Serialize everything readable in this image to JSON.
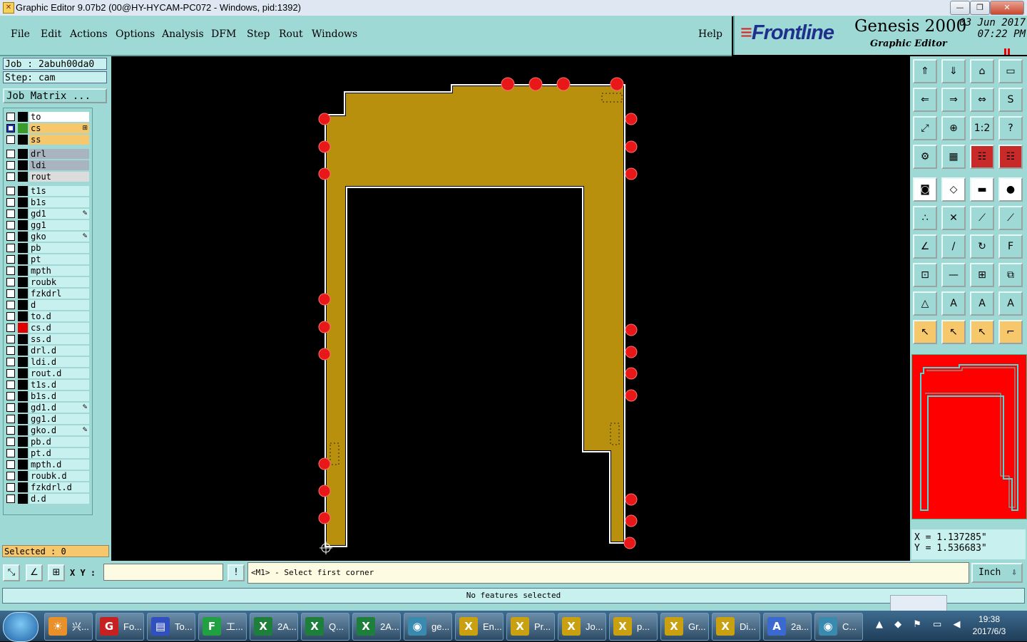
{
  "window": {
    "title": "Graphic Editor 9.07b2 (00@HY-HYCAM-PC072 - Windows, pid:1392)",
    "minimize": "—",
    "maximize": "❐",
    "close": "✕"
  },
  "menu": [
    "File",
    "Edit",
    "Actions",
    "Options",
    "Analysis",
    "DFM",
    "Step",
    "Rout",
    "Windows",
    "Help"
  ],
  "brand": {
    "logo": "Frontline",
    "product": "Genesis 2000",
    "subtitle": "Graphic Editor",
    "date": "03 Jun 2017",
    "time": "07:22 PM"
  },
  "job": {
    "job_label": "Job : 2abuh00da0",
    "step_label": "Step: cam",
    "matrix_button": "Job Matrix ..."
  },
  "layers": [
    {
      "name": "to",
      "color": "#ffffff",
      "swatch": "#000000",
      "checked": false
    },
    {
      "name": "cs",
      "color": "#f7c86b",
      "swatch": "#3a9a2a",
      "checked": true,
      "mark": "⊞"
    },
    {
      "name": "ss",
      "color": "#f7c86b",
      "swatch": "#000000",
      "checked": false
    },
    {
      "name": "drl",
      "color": "#aab4c0",
      "swatch": "#000000",
      "checked": false,
      "gap": true
    },
    {
      "name": "ldi",
      "color": "#aab4c0",
      "swatch": "#000000",
      "checked": false
    },
    {
      "name": "rout",
      "color": "#dcdcdc",
      "swatch": "#000000",
      "checked": false
    },
    {
      "name": "t1s",
      "color": "#c8f0ee",
      "swatch": "#000000",
      "checked": false,
      "gap": true
    },
    {
      "name": "b1s",
      "color": "#c8f0ee",
      "swatch": "#000000",
      "checked": false
    },
    {
      "name": "gd1",
      "color": "#c8f0ee",
      "swatch": "#000000",
      "checked": false,
      "mark": "✎"
    },
    {
      "name": "gg1",
      "color": "#c8f0ee",
      "swatch": "#000000",
      "checked": false
    },
    {
      "name": "gko",
      "color": "#c8f0ee",
      "swatch": "#000000",
      "checked": false,
      "mark": "✎"
    },
    {
      "name": "pb",
      "color": "#c8f0ee",
      "swatch": "#000000",
      "checked": false
    },
    {
      "name": "pt",
      "color": "#c8f0ee",
      "swatch": "#000000",
      "checked": false
    },
    {
      "name": "mpth",
      "color": "#c8f0ee",
      "swatch": "#000000",
      "checked": false
    },
    {
      "name": "roubk",
      "color": "#c8f0ee",
      "swatch": "#000000",
      "checked": false
    },
    {
      "name": "fzkdrl",
      "color": "#c8f0ee",
      "swatch": "#000000",
      "checked": false
    },
    {
      "name": "d",
      "color": "#c8f0ee",
      "swatch": "#000000",
      "checked": false
    },
    {
      "name": "to.d",
      "color": "#c8f0ee",
      "swatch": "#000000",
      "checked": false
    },
    {
      "name": "cs.d",
      "color": "#c8f0ee",
      "swatch": "#e00000",
      "checked": false
    },
    {
      "name": "ss.d",
      "color": "#c8f0ee",
      "swatch": "#000000",
      "checked": false
    },
    {
      "name": "drl.d",
      "color": "#c8f0ee",
      "swatch": "#000000",
      "checked": false
    },
    {
      "name": "ldi.d",
      "color": "#c8f0ee",
      "swatch": "#000000",
      "checked": false
    },
    {
      "name": "rout.d",
      "color": "#c8f0ee",
      "swatch": "#000000",
      "checked": false
    },
    {
      "name": "t1s.d",
      "color": "#c8f0ee",
      "swatch": "#000000",
      "checked": false
    },
    {
      "name": "b1s.d",
      "color": "#c8f0ee",
      "swatch": "#000000",
      "checked": false
    },
    {
      "name": "gd1.d",
      "color": "#c8f0ee",
      "swatch": "#000000",
      "checked": false,
      "mark": "✎"
    },
    {
      "name": "gg1.d",
      "color": "#c8f0ee",
      "swatch": "#000000",
      "checked": false
    },
    {
      "name": "gko.d",
      "color": "#c8f0ee",
      "swatch": "#000000",
      "checked": false,
      "mark": "✎"
    },
    {
      "name": "pb.d",
      "color": "#c8f0ee",
      "swatch": "#000000",
      "checked": false
    },
    {
      "name": "pt.d",
      "color": "#c8f0ee",
      "swatch": "#000000",
      "checked": false
    },
    {
      "name": "mpth.d",
      "color": "#c8f0ee",
      "swatch": "#000000",
      "checked": false
    },
    {
      "name": "roubk.d",
      "color": "#c8f0ee",
      "swatch": "#000000",
      "checked": false
    },
    {
      "name": "fzkdrl.d",
      "color": "#c8f0ee",
      "swatch": "#000000",
      "checked": false
    },
    {
      "name": "d.d",
      "color": "#c8f0ee",
      "swatch": "#000000",
      "checked": false
    }
  ],
  "selected_label": "Selected : 0",
  "tools": [
    {
      "icon": "⇑",
      "name": "page-up-tool",
      "style": ""
    },
    {
      "icon": "⇓",
      "name": "page-down-tool",
      "style": ""
    },
    {
      "icon": "⌂",
      "name": "home-tool",
      "style": ""
    },
    {
      "icon": "▭",
      "name": "window-tool",
      "style": ""
    },
    {
      "icon": "⇐",
      "name": "pan-left-tool",
      "style": ""
    },
    {
      "icon": "⇒",
      "name": "pan-right-tool",
      "style": ""
    },
    {
      "icon": "⇔",
      "name": "swap-tool",
      "style": ""
    },
    {
      "icon": "S",
      "name": "snap-tool",
      "style": ""
    },
    {
      "icon": "⤢",
      "name": "zoom-fit-tool",
      "style": ""
    },
    {
      "icon": "⊕",
      "name": "zoom-center-tool",
      "style": ""
    },
    {
      "icon": "1:2",
      "name": "zoom-ratio-tool",
      "style": ""
    },
    {
      "icon": "?",
      "name": "help-tool",
      "style": ""
    },
    {
      "icon": "⚙",
      "name": "settings-tool",
      "style": ""
    },
    {
      "icon": "▦",
      "name": "grid-tool",
      "style": ""
    },
    {
      "icon": "☷",
      "name": "layers-tool",
      "style": "red"
    },
    {
      "icon": "☷",
      "name": "layers-alt-tool",
      "style": "red"
    },
    {
      "icon": "◙",
      "name": "pad-tool",
      "style": "white"
    },
    {
      "icon": "◇",
      "name": "shape-tool",
      "style": "white"
    },
    {
      "icon": "▬",
      "name": "measure-tool",
      "style": "white"
    },
    {
      "icon": "●",
      "name": "dot-tool",
      "style": "white"
    },
    {
      "icon": "∴",
      "name": "nodes-tool",
      "style": ""
    },
    {
      "icon": "✕",
      "name": "cross-tool",
      "style": ""
    },
    {
      "icon": "⟋",
      "name": "line-tool",
      "style": ""
    },
    {
      "icon": "⟋",
      "name": "line-alt-tool",
      "style": ""
    },
    {
      "icon": "∠",
      "name": "angle-tool",
      "style": ""
    },
    {
      "icon": "/",
      "name": "slash-tool",
      "style": ""
    },
    {
      "icon": "↻",
      "name": "rotate-tool",
      "style": ""
    },
    {
      "icon": "F",
      "name": "mirror-tool",
      "style": ""
    },
    {
      "icon": "⊡",
      "name": "select-box-tool",
      "style": ""
    },
    {
      "icon": "—",
      "name": "hline-tool",
      "style": ""
    },
    {
      "icon": "⊞",
      "name": "resize-tool",
      "style": ""
    },
    {
      "icon": "⧉",
      "name": "copy-tool",
      "style": ""
    },
    {
      "icon": "△",
      "name": "triangle-tool",
      "style": ""
    },
    {
      "icon": "A",
      "name": "text-tool",
      "style": ""
    },
    {
      "icon": "A",
      "name": "text-up-tool",
      "style": ""
    },
    {
      "icon": "A",
      "name": "text-down-tool",
      "style": ""
    },
    {
      "icon": "↖",
      "name": "pointer-tool",
      "style": "yellow"
    },
    {
      "icon": "↖",
      "name": "pointer-box-tool",
      "style": "yellow"
    },
    {
      "icon": "↖",
      "name": "pointer-circle-tool",
      "style": "yellow"
    },
    {
      "icon": "⌐",
      "name": "route-tool",
      "style": "yellow"
    }
  ],
  "coords": {
    "x": "X = 1.137285\"",
    "y": "Y = 1.536683\""
  },
  "command": {
    "xy_label": "X Y :",
    "xy_value": "",
    "prompt": "<M1> - Select first corner",
    "units": "Inch",
    "units_arrow": "⇩"
  },
  "status": "No features selected",
  "taskbar": [
    {
      "label": "兴...",
      "icon": "☀",
      "color": "#e8902a"
    },
    {
      "label": "Fo...",
      "icon": "G",
      "color": "#c62020"
    },
    {
      "label": "To...",
      "icon": "▤",
      "color": "#3050c0"
    },
    {
      "label": "工...",
      "icon": "F",
      "color": "#20a040"
    },
    {
      "label": "2A...",
      "icon": "X",
      "color": "#1e7e3c"
    },
    {
      "label": "Q...",
      "icon": "X",
      "color": "#1e7e3c"
    },
    {
      "label": "2A...",
      "icon": "X",
      "color": "#1e7e3c"
    },
    {
      "label": "ge...",
      "icon": "◉",
      "color": "#3a8ab0"
    },
    {
      "label": "En...",
      "icon": "X",
      "color": "#c8a010"
    },
    {
      "label": "Pr...",
      "icon": "X",
      "color": "#c8a010"
    },
    {
      "label": "Jo...",
      "icon": "X",
      "color": "#c8a010"
    },
    {
      "label": "p...",
      "icon": "X",
      "color": "#c8a010"
    },
    {
      "label": "Gr...",
      "icon": "X",
      "color": "#c8a010"
    },
    {
      "label": "Di...",
      "icon": "X",
      "color": "#c8a010"
    },
    {
      "label": "2a...",
      "icon": "A",
      "color": "#3a6ad0"
    },
    {
      "label": "C...",
      "icon": "◉",
      "color": "#3a8ab0"
    }
  ],
  "clock": {
    "time": "19:38",
    "date": "2017/6/3"
  },
  "tray": "▲ ◆ ⚑ ▭ ◀",
  "colors": {
    "board": "#b8900e",
    "pad": "#e81818",
    "panel": "#9ed9d6",
    "outline": "#ffffff"
  }
}
